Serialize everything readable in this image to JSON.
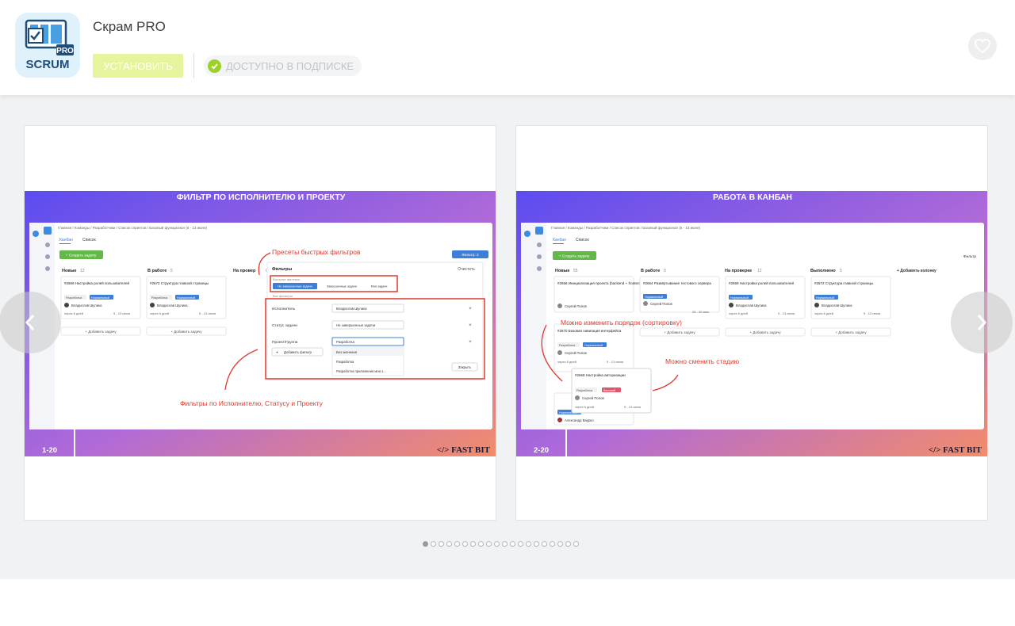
{
  "app": {
    "title": "Скрам PRO",
    "icon_label": "SCRUM",
    "icon_badge": "PRO",
    "install_label": "УСТАНОВИТЬ",
    "subscription_label": "ДОСТУПНО В ПОДПИСКЕ",
    "favorite_icon": "heart-icon"
  },
  "colors": {
    "install_bg": "#e6f49e",
    "check_green": "#9cd129",
    "gradient_purple": "#7b6cf0",
    "gradient_orange": "#f08a6a"
  },
  "slides": [
    {
      "heading": "ФИЛЬТР ПО ИСПОЛНИТЕЛЮ И ПРОЕКТУ",
      "page": "1-20",
      "brand": "</> FAST BIT",
      "breadcrumb": "Главная / Команды / Разработчики / Список спринтов / Базовый функционал (6 - 13 июня)",
      "tabs": [
        "Канбан",
        "Список"
      ],
      "create_task": "+ Создать задачу",
      "columns": [
        {
          "name": "Новые",
          "count": "12"
        },
        {
          "name": "В работе",
          "count": "5"
        },
        {
          "name": "На провер",
          "count": "0"
        }
      ],
      "card1": {
        "title": "#2669 Настройка ролей пользователей",
        "tag1": "Разработка",
        "tag2": "Нормальный",
        "user": "Владислав Шулика",
        "due": "через 6 дней",
        "dates": "9 - 13 июня"
      },
      "card2": {
        "title": "#2672 Структура главной страницы",
        "tag1": "Разработка",
        "tag2": "Нормальный",
        "user": "Владислав Шулика",
        "due": "через 6 дней",
        "dates": "9 - 13 июня"
      },
      "add_task": "+ Добавить задачу",
      "annotation_top": "Пресеты быстрых фильтров",
      "annotation_bottom": "Фильтры по Исполнителю, Статусу и Проекту",
      "filter_btn": "Фильтр: 2",
      "filters": {
        "title": "Фильтры",
        "clear": "Очистить",
        "quick_label": "Быстрые фильтры",
        "quick": [
          "Не завершенные задачи",
          "Завершенные задачи",
          "Мои задачи"
        ],
        "all_label": "Все фильтры",
        "rows": [
          {
            "label": "Исполнитель",
            "value": "Владислав Шулика"
          },
          {
            "label": "Статус задачи",
            "value": "Не завершенные задачи"
          },
          {
            "label": "Проект/Группа",
            "value": "Разработка"
          }
        ],
        "options": [
          "Без значения",
          "Разработка",
          "Разработка приложения мои з..."
        ],
        "add_filter": "Добавить фильтр",
        "close": "Закрыть"
      }
    },
    {
      "heading": "РАБОТА В КАНБАН",
      "page": "2-20",
      "brand": "</> FAST BIT",
      "breadcrumb": "Главная / Команды / Разработчики / Список спринтов / Базовый функционал (6 - 13 июня)",
      "tabs": [
        "Канбан",
        "Список"
      ],
      "create_task": "+ Создать задачу",
      "filter_btn": "Фильтр",
      "columns": [
        {
          "name": "Новые",
          "count": "55"
        },
        {
          "name": "В работе",
          "count": "0"
        },
        {
          "name": "На проверке",
          "count": "12"
        },
        {
          "name": "Выполнено",
          "count": "5"
        }
      ],
      "add_column": "+ Добавить колонку",
      "card1": {
        "title": "#2666 Инициализация проекта (backend + frontend)",
        "tag": "Разработка",
        "tag2": "Нормальный",
        "user": "Сергей Попов",
        "dates": "26 - 30 мая"
      },
      "card2": {
        "title": "#2664 Развёртывание тестового сервера",
        "tag": "Нормальный",
        "user": "Сергей Попов",
        "dates": "26 - 30 мая"
      },
      "card3": {
        "title": "#2669 Настройка ролей пользователей",
        "tag": "Нормальный",
        "user": "Владислав Шулика",
        "due": "через 6 дней",
        "dates": "9 - 13 июня"
      },
      "card4": {
        "title": "#2672 Структура главной страницы",
        "tag": "Нормальный",
        "user": "Владислав Шулика",
        "due": "через 6 дней",
        "dates": "9 - 13 июня"
      },
      "card5": {
        "title": "#2670 Базовая навигация интерфейса",
        "tag": "Разработка",
        "tag2": "Нормальный",
        "user": "Сергей Попов",
        "due": "через 6 дней",
        "dates": "9 - 13 июня"
      },
      "drag": {
        "title": "#2668 Настройка авторизации",
        "tag": "Разработка",
        "tag2": "Высокий",
        "user": "Сергей Попов",
        "due": "через 6 дней",
        "dates": "9 - 13 июня"
      },
      "card6": {
        "tag": "Нормальный",
        "user": "Александр Ваурко"
      },
      "add_task": "+ Добавить задачу",
      "annotation_top": "Можно изменить порядок (сортировку)",
      "annotation_right": "Можно сменить стадию"
    }
  ],
  "pagination": {
    "total": 20,
    "active_index": 0
  }
}
